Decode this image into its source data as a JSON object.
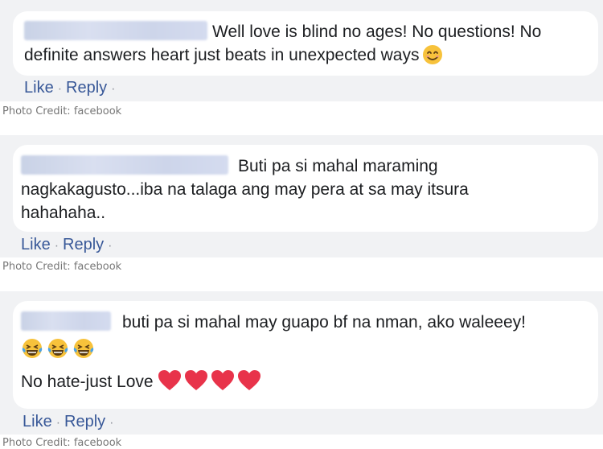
{
  "comments": [
    {
      "text_line1": "Well love is blind no ages! No questions! No",
      "text_line2": "definite answers heart just beats in unexpected ways",
      "emoji": "smiling-face-icon",
      "like_label": "Like",
      "reply_label": "Reply",
      "separator": "·",
      "credit": "Photo Credit: facebook"
    },
    {
      "text_line1": "Buti pa si mahal maraming",
      "text_line2": "nagkakagusto...iba na talaga ang may pera at sa may itsura",
      "text_line3": "hahahaha..",
      "like_label": "Like",
      "reply_label": "Reply",
      "separator": "·",
      "credit": "Photo Credit: facebook"
    },
    {
      "text_line1": "buti pa si mahal may guapo bf na nman, ako waleeey!",
      "emoji_row": [
        "laughing-tears-icon",
        "laughing-tears-icon",
        "laughing-tears-icon"
      ],
      "text_line2": "No hate-just Love",
      "hearts": [
        "heart-icon",
        "heart-icon",
        "heart-icon",
        "heart-icon"
      ],
      "like_label": "Like",
      "reply_label": "Reply",
      "separator": "·",
      "credit": "Photo Credit: facebook"
    }
  ],
  "colors": {
    "link": "#385898",
    "panel": "#f1f2f4",
    "text": "#1c1e21",
    "heart": "#e8334a",
    "emoji": "#f7c23b"
  }
}
